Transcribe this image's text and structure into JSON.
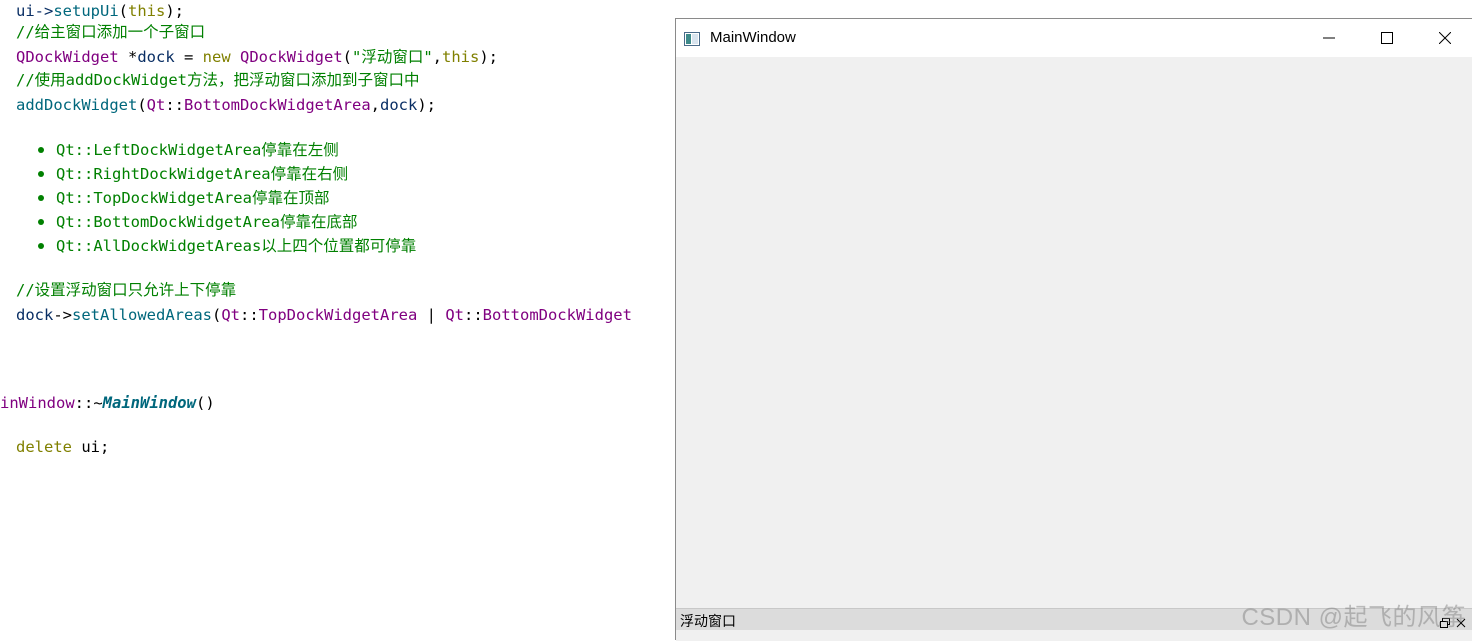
{
  "editor": {
    "line1": {
      "a": "ui->",
      "b": "setupUi",
      "c": "(",
      "d": "this",
      "e": ");"
    },
    "comment_add_dock": "//给主窗口添加一个子窗口",
    "line3": {
      "a": "QDockWidget",
      "b": " *",
      "c": "dock",
      "d": " = ",
      "e": "new",
      "f": " ",
      "g": "QDockWidget",
      "h": "(",
      "i": "\"浮动窗口\"",
      "j": ",",
      "k": "this",
      "l": ");"
    },
    "comment_add_method": "//使用addDockWidget方法，把浮动窗口添加到子窗口中",
    "line5": {
      "a": "addDockWidget",
      "b": "(",
      "c": "Qt",
      "d": "::",
      "e": "BottomDockWidgetArea",
      "f": ",",
      "g": "dock",
      "h": ");"
    },
    "bullets": [
      "Qt::LeftDockWidgetArea停靠在左侧",
      "Qt::RightDockWidgetArea停靠在右侧",
      "Qt::TopDockWidgetArea停靠在顶部",
      "Qt::BottomDockWidgetArea停靠在底部",
      "Qt::AllDockWidgetAreas以上四个位置都可停靠"
    ],
    "comment_allowed": "//设置浮动窗口只允许上下停靠",
    "line_allowed": {
      "a": "dock",
      "b": "->",
      "c": "setAllowedAreas",
      "d": "(",
      "e": "Qt",
      "f": "::",
      "g": "TopDockWidgetArea",
      "h": " | ",
      "i": "Qt",
      "j": "::",
      "k": "BottomDockWidget"
    },
    "destructor": {
      "a": "inWindow",
      "b": "::~",
      "c": "MainWindow",
      "d": "()"
    },
    "delete_line": {
      "a": "delete",
      "b": " ui;"
    }
  },
  "window": {
    "title": "MainWindow",
    "dock_title": "浮动窗口",
    "icon": "qt-window-icon"
  },
  "watermark": "CSDN @起飞的风筝"
}
